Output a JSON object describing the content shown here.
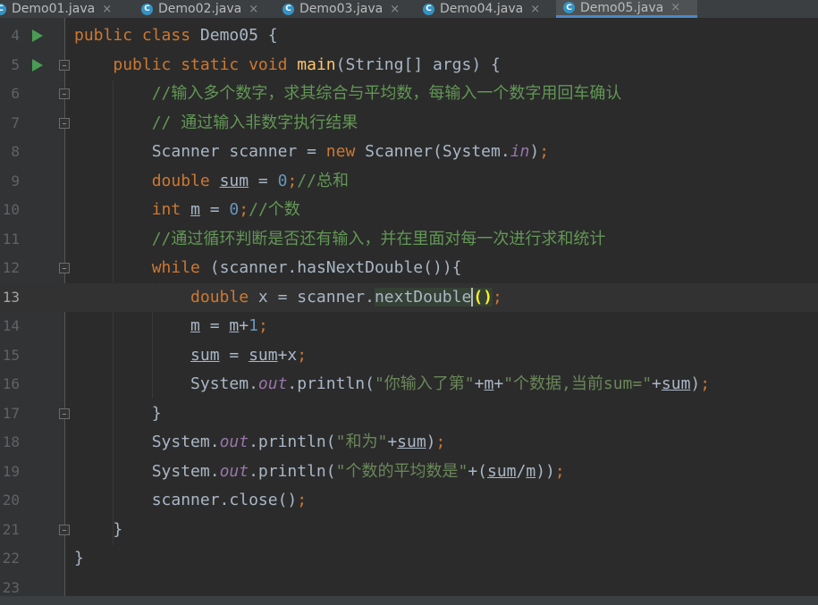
{
  "tabs": [
    {
      "label": "Demo01.java",
      "active": false
    },
    {
      "label": "Demo02.java",
      "active": false
    },
    {
      "label": "Demo03.java",
      "active": false
    },
    {
      "label": "Demo04.java",
      "active": false
    },
    {
      "label": "Demo05.java",
      "active": true
    }
  ],
  "tab_icon_letter": "C",
  "tab_close": "×",
  "lines": [
    {
      "no": "4"
    },
    {
      "no": "5"
    },
    {
      "no": "6"
    },
    {
      "no": "7"
    },
    {
      "no": "8"
    },
    {
      "no": "9"
    },
    {
      "no": "10"
    },
    {
      "no": "11"
    },
    {
      "no": "12"
    },
    {
      "no": "13"
    },
    {
      "no": "14"
    },
    {
      "no": "15"
    },
    {
      "no": "16"
    },
    {
      "no": "17"
    },
    {
      "no": "18"
    },
    {
      "no": "19"
    },
    {
      "no": "20"
    },
    {
      "no": "21"
    },
    {
      "no": "22"
    },
    {
      "no": "23"
    }
  ],
  "code": {
    "l4_kw": "public class ",
    "l4_name": "Demo05 {",
    "l5_kw": "public static void ",
    "l5_fn": "main",
    "l5_rest": "(String[] args) {",
    "l6_comment": "//输入多个数字，求其综合与平均数，每输入一个数字用回车确认",
    "l7_comment": "// 通过输入非数字执行结果",
    "l8_a": "Scanner scanner = ",
    "l8_new": "new ",
    "l8_b": "Scanner(System.",
    "l8_in": "in",
    "l8_c": ")",
    "l8_semi": ";",
    "l9_kw": "double ",
    "l9_var": "sum",
    "l9_eq": " = ",
    "l9_num": "0",
    "l9_semi": ";",
    "l9_comment": "//总和",
    "l10_kw": "int ",
    "l10_var": "m",
    "l10_eq": " = ",
    "l10_num": "0",
    "l10_semi": ";",
    "l10_comment": "//个数",
    "l11_comment": "//通过循环判断是否还有输入，并在里面对每一次进行求和统计",
    "l12_kw": "while ",
    "l12_rest": "(scanner.hasNextDouble()){",
    "l13_kw": "double ",
    "l13_a": "x = scanner.",
    "l13_call": "nextDouble",
    "l13_paren": "()",
    "l13_semi": ";",
    "l14_var": "m",
    "l14_eq": " = ",
    "l14_var2": "m",
    "l14_plus": "+",
    "l14_num": "1",
    "l14_semi": ";",
    "l15_var": "sum",
    "l15_eq": " = ",
    "l15_var2": "sum",
    "l15_rest": "+x",
    "l15_semi": ";",
    "l16_a": "System.",
    "l16_out": "out",
    "l16_b": ".println(",
    "l16_s1": "\"你输入了第\"",
    "l16_p1": "+",
    "l16_m": "m",
    "l16_p2": "+",
    "l16_s2": "\"个数据,当前sum=\"",
    "l16_p3": "+",
    "l16_sum": "sum",
    "l16_c": ")",
    "l16_semi": ";",
    "l17": "}",
    "l18_a": "System.",
    "l18_out": "out",
    "l18_b": ".println(",
    "l18_s": "\"和为\"",
    "l18_p": "+",
    "l18_sum": "sum",
    "l18_c": ")",
    "l18_semi": ";",
    "l19_a": "System.",
    "l19_out": "out",
    "l19_b": ".println(",
    "l19_s": "\"个数的平均数是\"",
    "l19_p": "+(",
    "l19_sum": "sum",
    "l19_slash": "/",
    "l19_m": "m",
    "l19_c": "))",
    "l19_semi": ";",
    "l20_a": "scanner.close()",
    "l20_semi": ";",
    "l21": "}",
    "l22": "}"
  },
  "colors": {
    "keyword": "#cc7832",
    "string": "#6a8759",
    "comment": "#629755",
    "number": "#6897bb",
    "static_field": "#9876aa",
    "method_decl": "#ffc66d",
    "background": "#2b2b2b"
  }
}
